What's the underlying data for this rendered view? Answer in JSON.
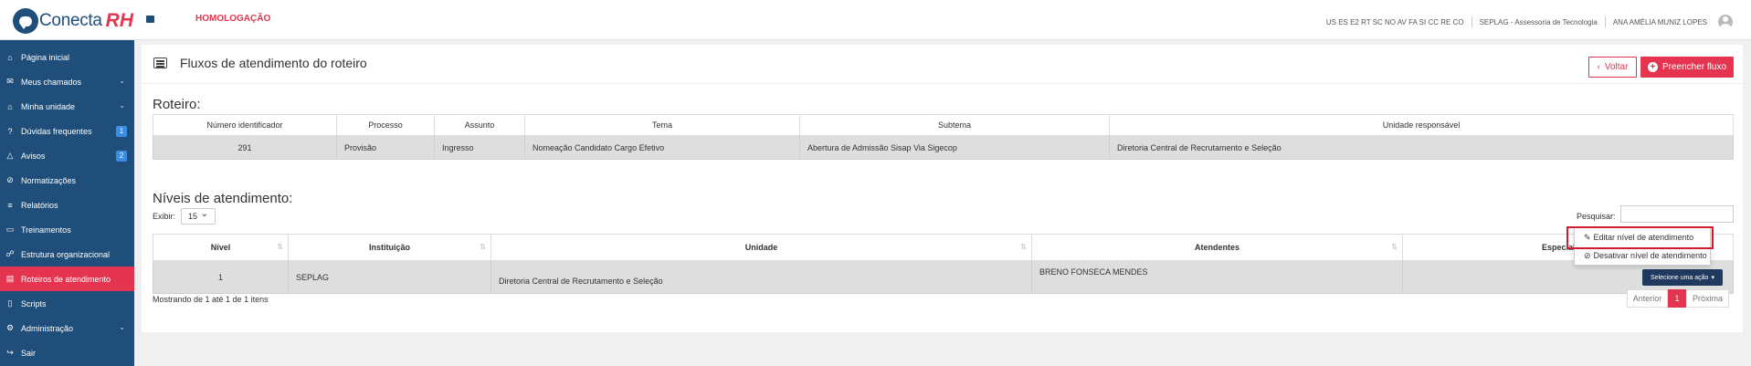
{
  "app": {
    "logo_text": "Conecta",
    "logo_rh": "RH",
    "environment": "HOMOLOGAÇÃO"
  },
  "header": {
    "states": "US ES E2 RT SC NO AV FA SI CC RE CO",
    "org": "SEPLAG - Assessoria de Tecnologia",
    "user": "ANA AMÉLIA MUNIZ LOPES"
  },
  "sidebar": {
    "items": [
      {
        "label": "Página inicial",
        "icon": "home-icon",
        "glyph": "⌂"
      },
      {
        "label": "Meus chamados",
        "icon": "envelope-icon",
        "glyph": "✉",
        "chevron": true
      },
      {
        "label": "Minha unidade",
        "icon": "building-icon",
        "glyph": "⌂",
        "chevron": true
      },
      {
        "label": "Dúvidas frequentes",
        "icon": "question-icon",
        "glyph": "?",
        "badge": "1"
      },
      {
        "label": "Avisos",
        "icon": "bell-icon",
        "glyph": "△",
        "badge": "2"
      },
      {
        "label": "Normatizações",
        "icon": "ban-icon",
        "glyph": "⊘"
      },
      {
        "label": "Relatórios",
        "icon": "chart-icon",
        "glyph": "≡"
      },
      {
        "label": "Treinamentos",
        "icon": "presentation-icon",
        "glyph": "▭"
      },
      {
        "label": "Estrutura organizacional",
        "icon": "sitemap-icon",
        "glyph": "☍"
      },
      {
        "label": "Roteiros de atendimento",
        "icon": "list-icon",
        "glyph": "▤",
        "active": true
      },
      {
        "label": "Scripts",
        "icon": "file-icon",
        "glyph": "▯"
      },
      {
        "label": "Administração",
        "icon": "cogs-icon",
        "glyph": "⚙",
        "chevron": true
      },
      {
        "label": "Sair",
        "icon": "logout-icon",
        "glyph": "↪"
      }
    ]
  },
  "page": {
    "title": "Fluxos de atendimento do roteiro",
    "back_label": "Voltar",
    "fill_label": "Preencher fluxo"
  },
  "roteiro": {
    "title": "Roteiro:",
    "headers": [
      "Número identificador",
      "Processo",
      "Assunto",
      "Tema",
      "Subtema",
      "Unidade responsável"
    ],
    "row": [
      "291",
      "Provisão",
      "Ingresso",
      "Nomeação Candidato Cargo Efetivo",
      "Abertura de Admissão Sisap Via Sigecop",
      "Diretoria Central de Recrutamento e Seleção"
    ]
  },
  "niveis": {
    "title": "Níveis de atendimento:",
    "show_label": "Exibir:",
    "show_value": "15",
    "search_label": "Pesquisar:",
    "headers": [
      "Nível",
      "Instituição",
      "Unidade",
      "Atendentes",
      "Especialistas"
    ],
    "row": {
      "nivel": "1",
      "instituicao": "SEPLAG",
      "unidade": "Diretoria Central de Recrutamento e Seleção",
      "atendentes": "BRENO FONSECA MENDES",
      "especialistas": ""
    },
    "action_label": "Selecione uma ação",
    "dropdown": [
      "Editar nível de atendimento",
      "Desativar nível de atendimento"
    ],
    "info": "Mostrando de 1 até 1 de 1 itens",
    "pager": {
      "prev": "Anterior",
      "current": "1",
      "next": "Próxima"
    }
  }
}
